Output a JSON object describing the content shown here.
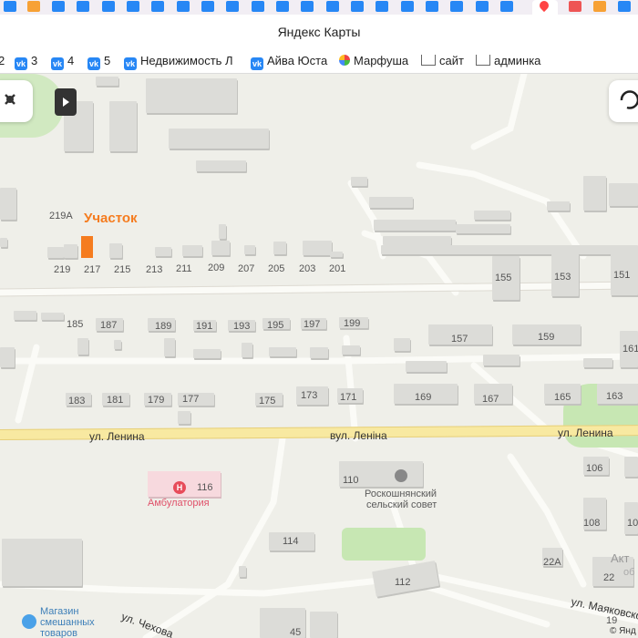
{
  "window": {
    "title": "Яндекс Карты"
  },
  "bookmarks": [
    {
      "label": "2",
      "icon": "vk-icon"
    },
    {
      "label": "3",
      "icon": "vk-icon"
    },
    {
      "label": "4",
      "icon": "vk-icon"
    },
    {
      "label": "5",
      "icon": "vk-icon"
    },
    {
      "label": "Недвижимость Л",
      "icon": "vk-icon"
    },
    {
      "label": "Айва Юста",
      "icon": "vk-icon"
    },
    {
      "label": "Марфуша",
      "icon": "flower-icon"
    },
    {
      "label": "сайт",
      "icon": "cart-icon"
    },
    {
      "label": "админка",
      "icon": "cart-icon"
    }
  ],
  "map": {
    "plot_label": "Участок",
    "streets": [
      "ул. Ленина",
      "вул. Леніна",
      "ул. Ленина",
      "ул. Чехова",
      "ул. Маяковско"
    ],
    "house_numbers": {
      "row1": [
        "219А",
        "219",
        "217",
        "215",
        "213",
        "211",
        "209",
        "207",
        "205",
        "203",
        "201"
      ],
      "row2": [
        "185",
        "187",
        "189",
        "191",
        "193",
        "195",
        "197",
        "199"
      ],
      "row3": [
        "183",
        "181",
        "179",
        "177",
        "175",
        "173",
        "171",
        "169",
        "167",
        "165",
        "163"
      ],
      "east": [
        "155",
        "153",
        "151",
        "157",
        "159",
        "161",
        "106",
        "108",
        "10",
        "22А",
        "22",
        "19"
      ],
      "south": [
        "110",
        "114",
        "112",
        "45",
        "116"
      ]
    },
    "pois": {
      "clinic": {
        "name": "Амбулатория",
        "number": "116",
        "letter": "Н"
      },
      "council": {
        "line1": "Роскошнянский",
        "line2": "сельский совет"
      },
      "shop": {
        "line1": "Магазин",
        "line2": "смешанных",
        "line3": "товаров"
      },
      "partial": {
        "line1": "Акт",
        "line2": "об"
      }
    },
    "copyright": "© Янд"
  },
  "colors": {
    "plot": "#f57c1f",
    "building": "#dcdcd8",
    "park": "#c7e7b3",
    "main_road": "#f8e9a1",
    "clinic": "#f7d9de"
  }
}
